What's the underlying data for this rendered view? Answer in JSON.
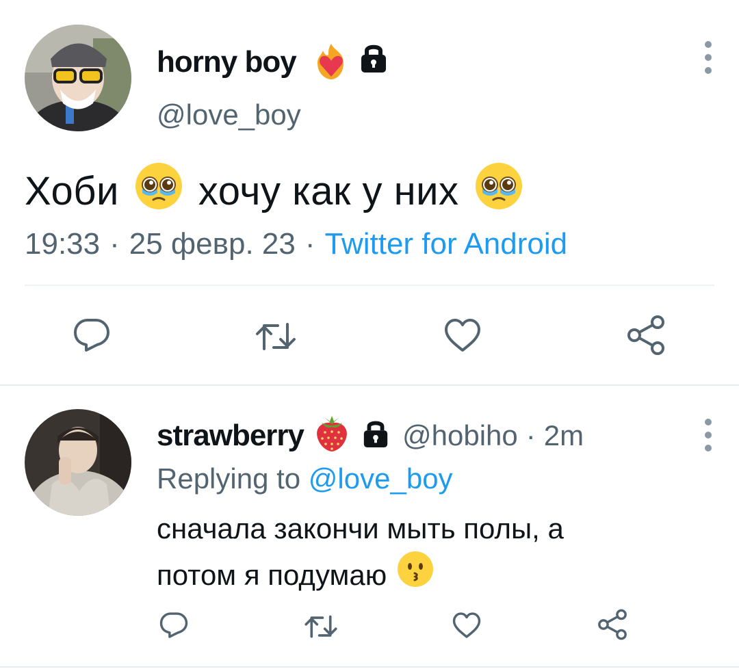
{
  "main_tweet": {
    "display_name": "horny boy",
    "handle": "@love_boy",
    "text_part1": "Хоби",
    "text_part2": "хочу как у них",
    "time": "19:33",
    "date": "25 февр. 23",
    "source": "Twitter for Android",
    "separator": "·",
    "icons": [
      "heart-on-fire-icon",
      "lock-icon",
      "pleading-face-emoji",
      "more-options-icon"
    ]
  },
  "main_actions": [
    "reply-icon",
    "retweet-icon",
    "like-icon",
    "share-icon"
  ],
  "reply": {
    "display_name": "strawberry",
    "handle": "@hobiho",
    "separator": "·",
    "time": "2m",
    "replying_prefix": "Replying to",
    "replying_mention": "@love_boy",
    "text_line1": "сначала закончи мыть полы, а",
    "text_line2": "потом я подумаю",
    "icons": [
      "strawberry-icon",
      "lock-icon",
      "kissing-face-emoji",
      "more-options-icon"
    ]
  },
  "reply_actions": [
    "reply-icon",
    "retweet-icon",
    "like-icon",
    "share-icon"
  ],
  "colors": {
    "text": "#0f1419",
    "secondary": "#536471",
    "link": "#1d9bf0",
    "icon": "#536471",
    "divider": "#eff3f4"
  }
}
